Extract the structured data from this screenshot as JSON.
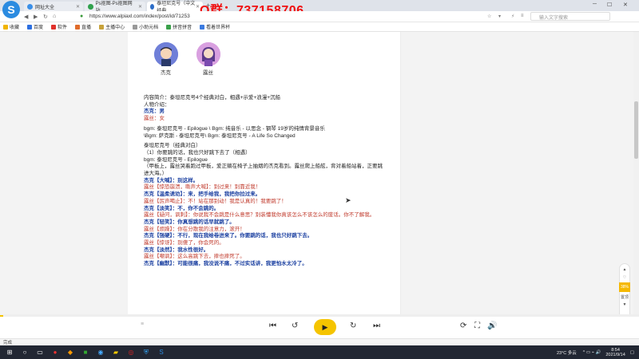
{
  "browser": {
    "tabs": [
      {
        "label": "网址大全"
      },
      {
        "label": "Ps抠图-Ps抠图网站..."
      },
      {
        "label": "泰坦尼克号（中文经典..."
      }
    ],
    "url": "https://www.alpiaxl.com/index/post/id/71253",
    "search_placeholder": "输入文字搜索",
    "bookmarks": [
      "收藏",
      "百度",
      "软件",
      "直播",
      "主播中心",
      "小助元档",
      "拼音拼音",
      "看着世界杯"
    ],
    "brand_color": "#2b8be0"
  },
  "overlay_text": "Q群：737158706",
  "article": {
    "characters": [
      {
        "name": "杰克"
      },
      {
        "name": "露丝"
      }
    ],
    "lines": [
      {
        "text": "内容简介：泰坦尼克号4个经典对白，相遇+示爱+浪漫+沉船",
        "style": "dark"
      },
      {
        "text": "人物介绍：",
        "style": "dark"
      },
      {
        "text": "杰克：男",
        "style": "blue"
      },
      {
        "text": "露丝：女",
        "style": "red"
      },
      {
        "text": "",
        "style": "sp"
      },
      {
        "text": "bgm:  泰坦尼克号  -  Epilogue  \\  Bgm:  纯音乐  -  以思念  -  钢琴  19岁的纯情背景音乐",
        "style": "dark"
      },
      {
        "text": "\\Bgm:  萨克斯  -  泰坦尼克号\\  Bgm:  泰坦尼克号  -  A  Life  So  Changed",
        "style": "dark"
      },
      {
        "text": "",
        "style": "sp"
      },
      {
        "text": "泰坦尼克号（经典对白）",
        "style": "dark"
      },
      {
        "text": "（1）你要跳的话，我也只好跳下去了（相遇）",
        "style": "dark"
      },
      {
        "text": "bgm:  泰坦尼克号  -  Epilogue",
        "style": "dark"
      },
      {
        "text": "（甲板上，露丝哭着跑过甲板，爱正躺在椅子上抽烟的杰克看到。露丝爬上船舷，背对着船站着，正要跳进大海。）",
        "style": "wrap"
      },
      {
        "text": "杰克【大喊】：别这样。",
        "style": "blue"
      },
      {
        "text": "露丝【惊恐崩溃，嘶声大喊】：别过来！别靠近我！",
        "style": "red"
      },
      {
        "text": "杰克【温柔诱劝】：来，把手给我，我把你拉过来。",
        "style": "blue"
      },
      {
        "text": "露丝【厉声喝止】：不！站在那别动！我是认真的！我要跳了！",
        "style": "red"
      },
      {
        "text": "杰克【淡笑】：不，你不会跳的。",
        "style": "blue"
      },
      {
        "text": "露丝【疑问，讽刺】：你说我不会跳是什么意思？别装懂我你真该怎么不该怎么的废话。你不了解我。",
        "style": "red-wrap"
      },
      {
        "text": "杰克【轻笑】：你真想跳的话早就跳了。",
        "style": "blue"
      },
      {
        "text": "露丝【烦躁】：你在分散我的注意力，滚开！",
        "style": "red"
      },
      {
        "text": "杰克【强硬】：不行，现在我给卷进来了。你要跳的话，我也只好跳下去。",
        "style": "blue"
      },
      {
        "text": "露丝【惊讶】：别傻了，你会死的。",
        "style": "red"
      },
      {
        "text": "杰克【淡然】：我水性很好。",
        "style": "blue"
      },
      {
        "text": "露丝【嘲讽】：这么高跳下去，摔也摔死了。",
        "style": "red"
      },
      {
        "text": "杰克【幽默】：可能很痛，我没说不痛，不过实话讲，我更怕水太冷了。",
        "style": "blue"
      }
    ]
  },
  "side_widget": {
    "percent": "38%",
    "label": "置顶"
  },
  "player": {
    "progress": 0.005
  },
  "status": {
    "left": "完成"
  },
  "taskbar": {
    "weather": "23°C 多云",
    "time": "8:54",
    "date": "2021/9/14"
  }
}
